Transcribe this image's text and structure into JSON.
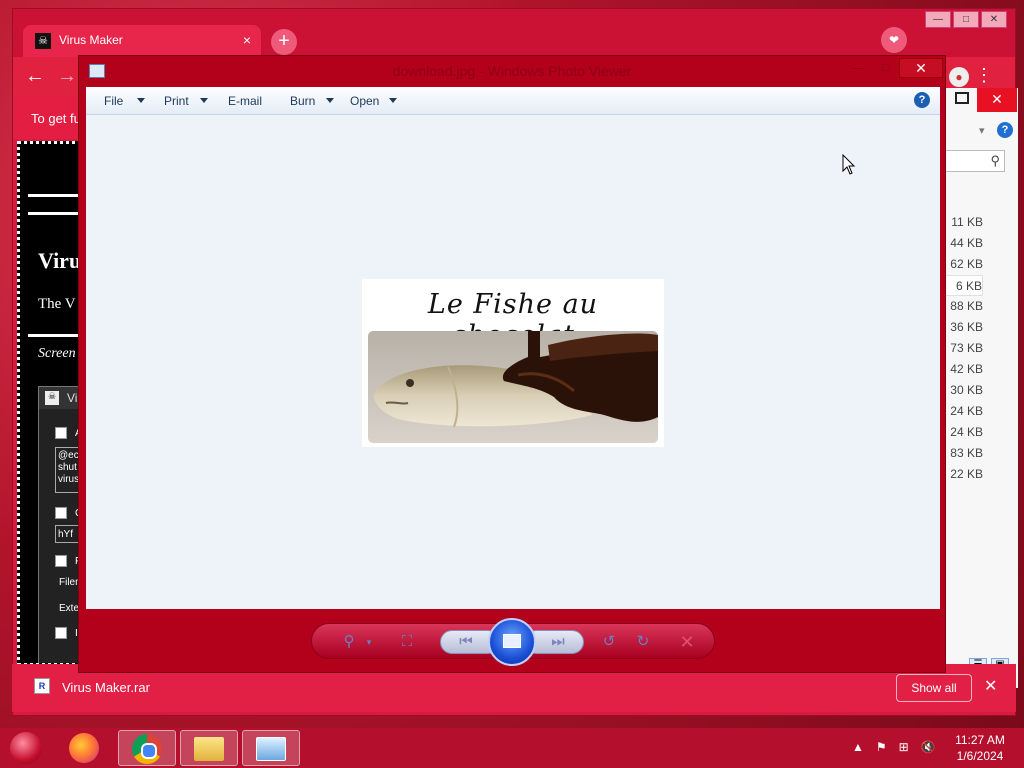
{
  "browser": {
    "tab_title": "Virus Maker",
    "tab_close": "×",
    "new_tab": "+",
    "back": "←",
    "forward": "→",
    "infobar_text": "To get fu",
    "window_controls": [
      "—",
      "□",
      "✕"
    ],
    "page_left": {
      "title": "Viru",
      "subtitle": "The V",
      "screen_label": "Screen",
      "inner_window_letter": "Vi",
      "lines": [
        "A",
        "@ec",
        "shut",
        "virus",
        "C",
        "hYf",
        "F",
        "Filen",
        "Exte",
        "I"
      ]
    }
  },
  "downloads_bar": {
    "file_name": "Virus Maker.rar",
    "file_badge": "R",
    "show_all": "Show all",
    "close": "✕"
  },
  "explorer": {
    "close": "✕",
    "sizes": [
      "11 KB",
      "44 KB",
      "62 KB",
      "6 KB",
      "88 KB",
      "36 KB",
      "73 KB",
      "42 KB",
      "30 KB",
      "24 KB",
      "24 KB",
      "83 KB",
      "22 KB"
    ],
    "selected_index": 3
  },
  "photo_viewer": {
    "title": "download.jpg - Windows Photo Viewer",
    "min": "—",
    "max": "□",
    "close": "✕",
    "menu": [
      {
        "label": "File",
        "has_arrow": true
      },
      {
        "label": "Print",
        "has_arrow": true
      },
      {
        "label": "E-mail",
        "has_arrow": false
      },
      {
        "label": "Burn",
        "has_arrow": true
      },
      {
        "label": "Open",
        "has_arrow": true
      }
    ],
    "help": "?",
    "photo_caption": "Le Fishe au chocolat",
    "controls": {
      "zoom": "⚲",
      "actual_size": "⛶",
      "previous": "⏮",
      "next": "⏭",
      "rotate_ccw": "↺",
      "rotate_cw": "↻",
      "delete": "✕"
    }
  },
  "taskbar": {
    "apps": [
      "firefox",
      "chrome",
      "file-explorer",
      "photo-viewer"
    ],
    "active_app": "photo-viewer",
    "clock_time": "11:27 AM",
    "clock_date": "1/6/2024"
  }
}
